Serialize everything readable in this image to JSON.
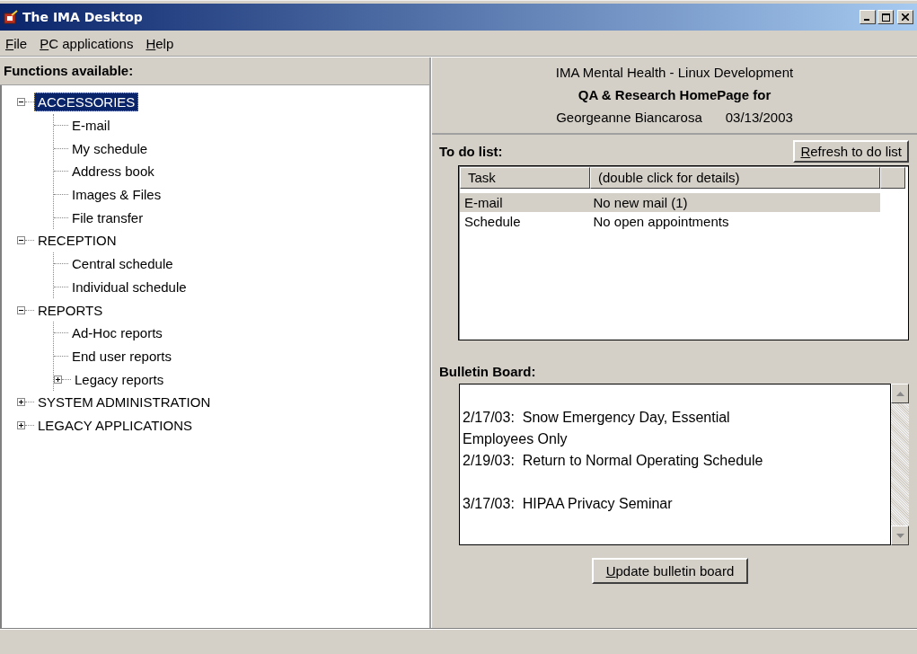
{
  "window": {
    "title": "The IMA Desktop"
  },
  "menu": [
    {
      "label": "File"
    },
    {
      "label": "PC applications"
    },
    {
      "label": "Help"
    }
  ],
  "functions": {
    "heading": "Functions available:",
    "tree": [
      {
        "label": "ACCESSORIES",
        "expanded": true,
        "selected": true,
        "children": [
          {
            "label": "E-mail",
            "selected": false
          },
          {
            "label": "My schedule",
            "selected": false
          },
          {
            "label": "Address book",
            "selected": false
          },
          {
            "label": "Images & Files",
            "selected": false
          },
          {
            "label": "File transfer",
            "selected": false
          }
        ]
      },
      {
        "label": "RECEPTION",
        "expanded": true,
        "selected": false,
        "children": [
          {
            "label": "Central schedule",
            "selected": false
          },
          {
            "label": "Individual schedule",
            "selected": false
          }
        ]
      },
      {
        "label": "REPORTS",
        "expanded": true,
        "selected": false,
        "children": [
          {
            "label": "Ad-Hoc reports",
            "selected": false
          },
          {
            "label": "End user reports",
            "selected": false
          },
          {
            "label": "Legacy reports",
            "expanded": false,
            "selected": false
          }
        ]
      },
      {
        "label": "SYSTEM ADMINISTRATION",
        "expanded": false,
        "selected": false
      },
      {
        "label": "LEGACY APPLICATIONS",
        "expanded": false,
        "selected": false
      }
    ]
  },
  "header": {
    "line_1": "IMA Mental Health - Linux Development",
    "line_2": "QA & Research HomePage for",
    "user": "Georgeanne Biancarosa",
    "date": "03/13/2003"
  },
  "todo": {
    "heading": "To do list:",
    "refresh_button": "Refresh to do list",
    "columns": [
      "Task",
      "(double click for details)"
    ],
    "rows": [
      {
        "task": "E-mail",
        "details": "No new mail (1)",
        "selected": true
      },
      {
        "task": "Schedule",
        "details": "No open appointments",
        "selected": false
      }
    ]
  },
  "bulletin": {
    "heading": "Bulletin Board:",
    "text": "\n2/17/03:  Snow Emergency Day, Essential\nEmployees Only\n2/19/03:  Return to Normal Operating Schedule\n\n3/17/03:  HIPAA Privacy Seminar",
    "update_button": "Update bulletin board"
  }
}
